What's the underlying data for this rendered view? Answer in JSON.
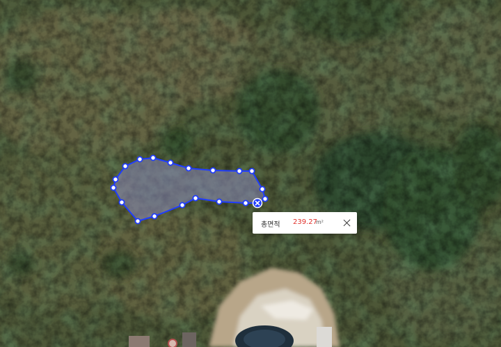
{
  "measurement": {
    "label": "총면적",
    "value": "239.27",
    "unit": "m²",
    "close_icon": "close-icon",
    "value_color": "#e0302a"
  },
  "polygon": {
    "stroke_color": "#1f3cff",
    "fill_color": "rgba(140,140,190,0.55)",
    "vertex_count": 20,
    "vertex_icon": "vertex-handle-icon",
    "delete_vertex_icon": "delete-vertex-icon"
  }
}
